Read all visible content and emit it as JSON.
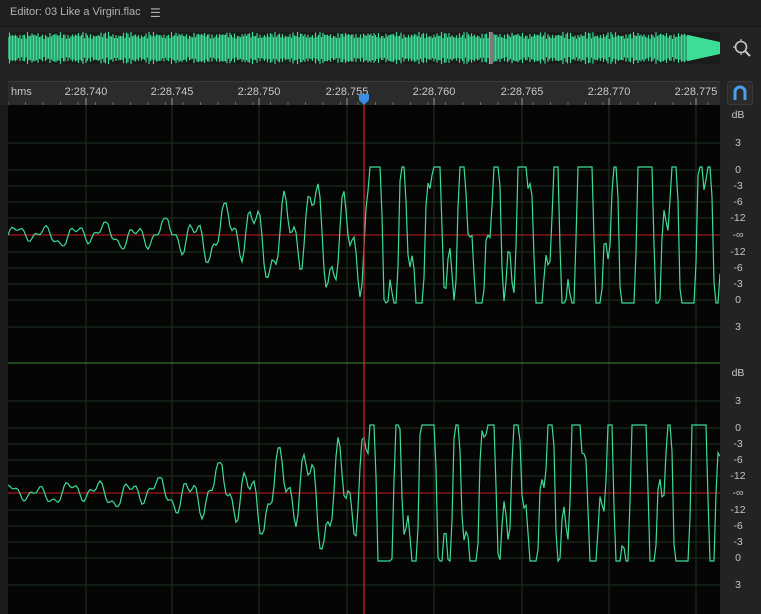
{
  "editor": {
    "title": "Editor: 03 Like a Virgin.flac",
    "menu_icon": "hamburger-menu-icon",
    "zoom_icon": "zoom-navigator-icon",
    "snap_icon": "snapping-magnet-icon"
  },
  "ruler": {
    "unit_label": "hms",
    "ticks": [
      "2:28.740",
      "2:28.745",
      "2:28.750",
      "2:28.755",
      "2:28.760",
      "2:28.765",
      "2:28.770",
      "2:28.775"
    ],
    "playhead_time": "2:28.755"
  },
  "channels": [
    {
      "scale_unit": "dB",
      "scale_labels": [
        "3",
        "0",
        "-3",
        "-6",
        "-12",
        "-∞",
        "-12",
        "-6",
        "-3",
        "0",
        "3"
      ]
    },
    {
      "scale_unit": "dB",
      "scale_labels": [
        "3",
        "0",
        "-3",
        "-6",
        "-12",
        "-∞",
        "-12",
        "-6",
        "-3",
        "0",
        "3"
      ]
    }
  ],
  "colors": {
    "waveform": "#3ddc97",
    "playhead": "#e0202a",
    "playhead_marker": "#3b8ee8",
    "grid": "#1c3a1c",
    "center_line": "#c41e2a"
  }
}
